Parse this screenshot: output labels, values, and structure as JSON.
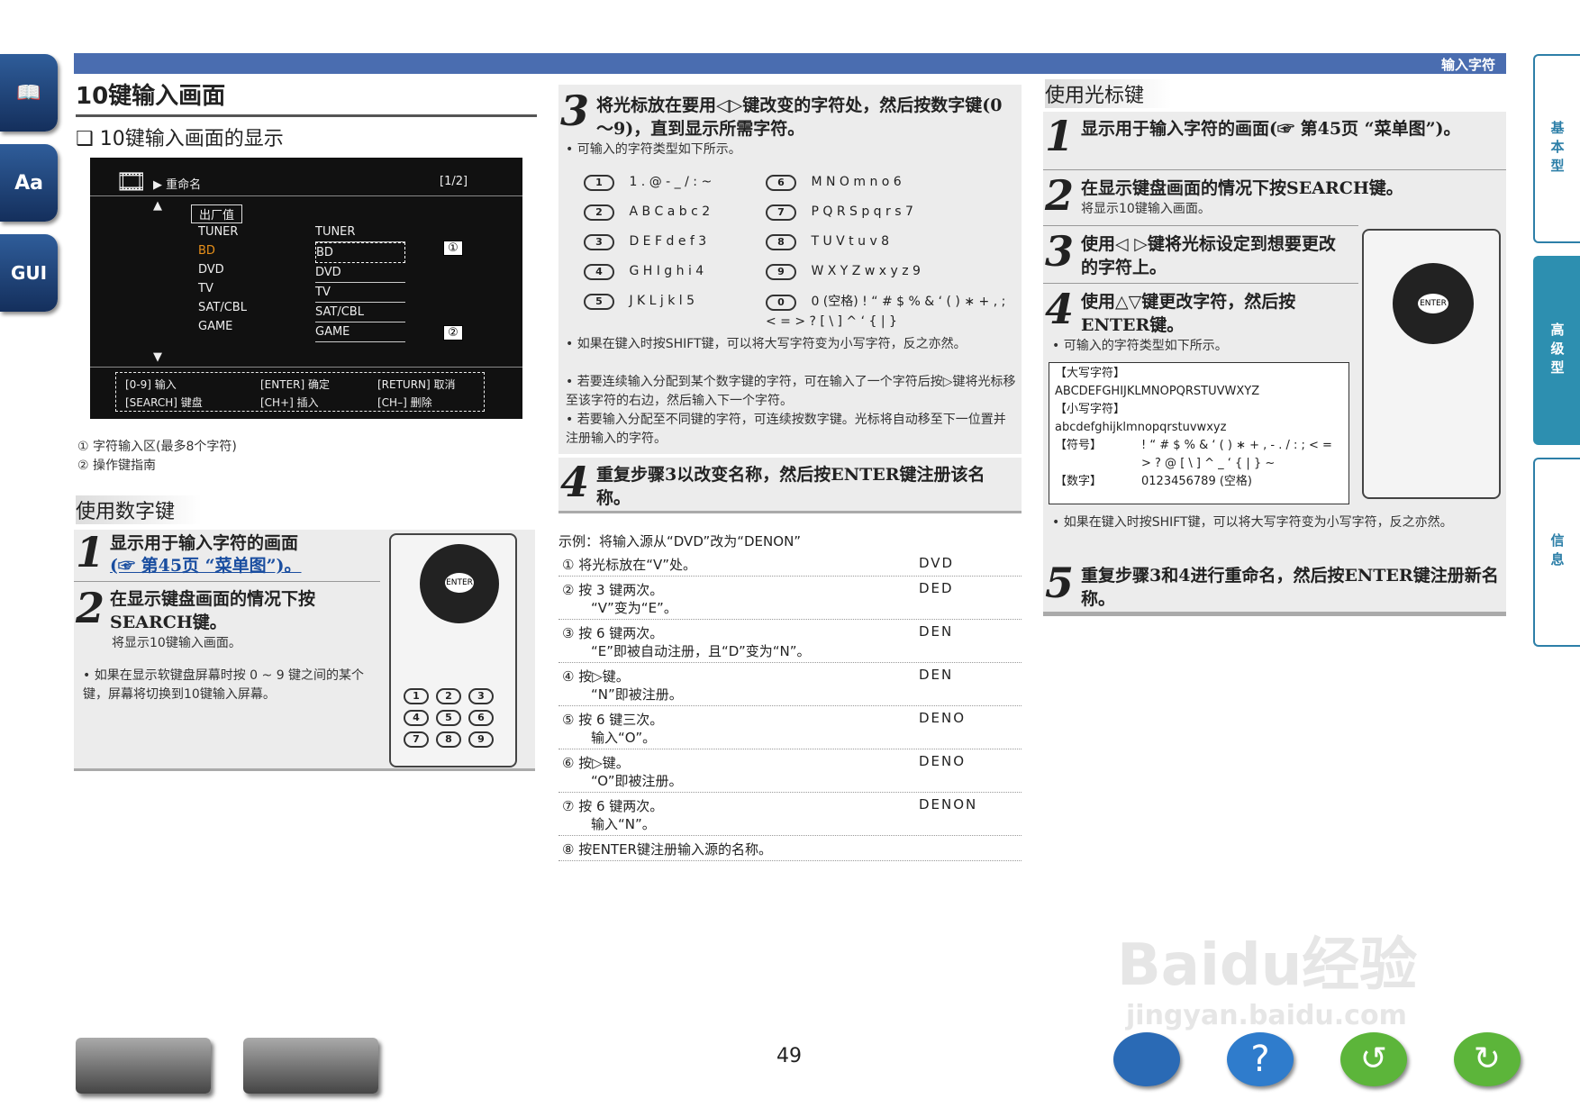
{
  "header": {
    "section": "输入字符"
  },
  "left_tabs": [
    "Aa",
    "GUI"
  ],
  "right_tabs": [
    "基本型",
    "高级型",
    "信息"
  ],
  "col1": {
    "title": "10键输入画面",
    "subtitle": "❑ 10键输入画面的显示",
    "screen": {
      "name": "重命名",
      "page": "[1/2]",
      "default_label": "出厂值",
      "sources": [
        "TUNER",
        "BD",
        "DVD",
        "TV",
        "SAT/CBL",
        "GAME"
      ],
      "names": [
        "TUNER",
        "BD",
        "DVD",
        "TV",
        "SAT/CBL",
        "GAME"
      ],
      "guide": [
        "[0-9] 输入",
        "[ENTER] 确定",
        "[RETURN] 取消",
        "[SEARCH] 键盘",
        "[CH+] 插入",
        "[CH–] 删除"
      ],
      "callouts": [
        "①",
        "②"
      ]
    },
    "notes": [
      "① 字符输入区(最多8个字符)",
      "② 操作键指南"
    ],
    "sub2": "使用数字键",
    "step1": "显示用于输入字符的画面",
    "step1b": "(☞ 第45页 “菜单图”)。",
    "step2": "在显示键盘画面的情况下按 SEARCH键。",
    "step2note": "将显示10键输入画面。",
    "tip": "• 如果在显示软键盘屏幕时按 0 ~ 9 键之间的某个键，屏幕将切换到10键输入屏幕。"
  },
  "col2": {
    "step3": "将光标放在要用◁▷键改变的字符处，然后按数字键(0～9)，直到显示所需字符。",
    "note": "• 可输入的字符类型如下所示。",
    "keys": [
      {
        "key": "1",
        "chars": "1 . @ - _ / : ~"
      },
      {
        "key": "2",
        "chars": "A B C a b c 2"
      },
      {
        "key": "3",
        "chars": "D E F d e f 3"
      },
      {
        "key": "4",
        "chars": "G H I g h i 4"
      },
      {
        "key": "5",
        "chars": "J K L j k l 5"
      },
      {
        "key": "6",
        "chars": "M N O m n o 6"
      },
      {
        "key": "7",
        "chars": "P Q R S p q r s 7"
      },
      {
        "key": "8",
        "chars": "T U V t u v 8"
      },
      {
        "key": "9",
        "chars": "W X Y Z w x y z 9"
      },
      {
        "key": "0",
        "chars": "0 (空格) ! “ # $ % & ‘ ( ) ∗ + , ; < = > ? [ \\ ] ^ ‘ { | }"
      }
    ],
    "tips": [
      "• 如果在键入时按SHIFT键，可以将大写字符变为小写字符，反之亦然。",
      "• 若要连续输入分配到某个数字键的字符，可在输入了一个字符后按▷键将光标移至该字符的右边，然后输入下一个字符。",
      "• 若要输入分配至不同键的字符，可连续按数字键。光标将自动移至下一位置并注册输入的字符。"
    ],
    "step4": "重复步骤3以改变名称，然后按ENTER键注册该名称。",
    "example_title": "示例：将输入源从“DVD”改为“DENON”",
    "examples": [
      {
        "text": "① 将光标放在“V”处。",
        "sub": "",
        "result": "DVD"
      },
      {
        "text": "② 按 3 键两次。",
        "sub": "“V”变为“E”。",
        "result": "DED"
      },
      {
        "text": "③ 按 6 键两次。",
        "sub": "“E”即被自动注册，且“D”变为“N”。",
        "result": "DEN"
      },
      {
        "text": "④ 按▷键。",
        "sub": "“N”即被注册。",
        "result": "DEN"
      },
      {
        "text": "⑤ 按 6 键三次。",
        "sub": "输入“O”。",
        "result": "DENO"
      },
      {
        "text": "⑥ 按▷键。",
        "sub": "“O”即被注册。",
        "result": "DENO"
      },
      {
        "text": "⑦ 按 6 键两次。",
        "sub": "输入“N”。",
        "result": "DENON"
      },
      {
        "text": "⑧ 按ENTER键注册输入源的名称。",
        "sub": "",
        "result": ""
      }
    ]
  },
  "col3": {
    "title": "使用光标键",
    "step1": "显示用于输入字符的画面(☞ 第45页 “菜单图”)。",
    "step2": "在显示键盘画面的情况下按SEARCH键。",
    "step2note": "将显示10键输入画面。",
    "step3": "使用◁ ▷键将光标设定到想要更改的字符上。",
    "step4": "使用△▽键更改字符，然后按ENTER键。",
    "step4note": "• 可输入的字符类型如下所示。",
    "chars": [
      {
        "label": "【大写字符】",
        "value": "ABCDEFGHIJKLMNOPQRSTUVWXYZ"
      },
      {
        "label": "【小写字符】",
        "value": "abcdefghijklmnopqrstuvwxyz"
      },
      {
        "label": "【符号】",
        "value": "! “ # $ % & ‘ ( ) ∗ + , - . / : ; < = > ? @ [ \\ ] ^ _ ‘ { | } ~"
      },
      {
        "label": "【数字】",
        "value": "0123456789 (空格)"
      }
    ],
    "tip": "• 如果在键入时按SHIFT键，可以将大写字符变为小写字符，反之亦然。",
    "step5": "重复步骤3和4进行重命名，然后按ENTER键注册新名称。"
  },
  "footer": {
    "page": "49",
    "watermark": "Baidu经验",
    "watermark2": "jingyan.baidu.com"
  }
}
